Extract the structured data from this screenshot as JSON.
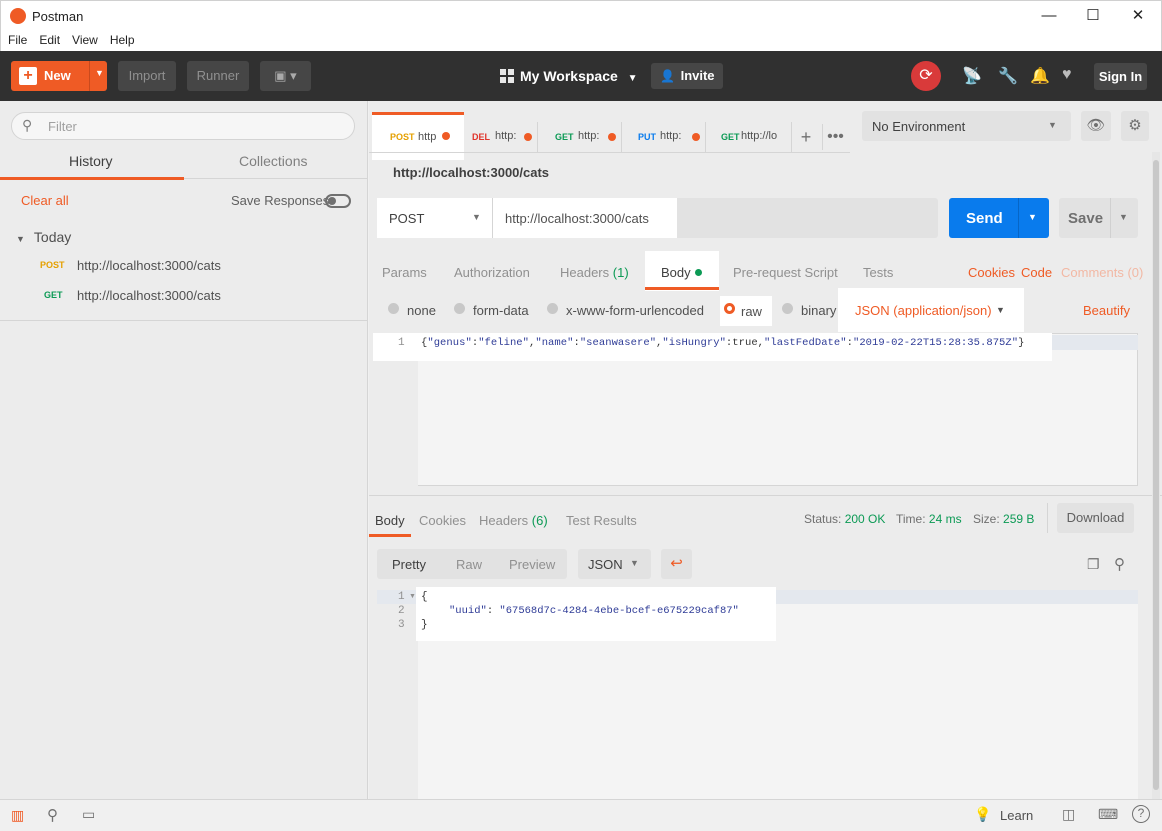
{
  "window": {
    "title": "Postman",
    "minimize": "—",
    "maximize": "☐",
    "close": "✕"
  },
  "menu": [
    "File",
    "Edit",
    "View",
    "Help"
  ],
  "header": {
    "new_label": "New",
    "import_label": "Import",
    "runner_label": "Runner",
    "workspace_label": "My Workspace",
    "invite_label": "Invite",
    "signin_label": "Sign In"
  },
  "sidebar": {
    "filter_placeholder": "Filter",
    "tabs": [
      "History",
      "Collections"
    ],
    "clear_all": "Clear all",
    "save_responses": "Save Responses",
    "group": "Today",
    "items": [
      {
        "method": "POST",
        "url": "http://localhost:3000/cats",
        "color": "#e5a000"
      },
      {
        "method": "GET",
        "url": "http://localhost:3000/cats",
        "color": "#0c9a55"
      }
    ]
  },
  "request_tabs": [
    {
      "method": "POST",
      "label": "http",
      "color": "#e5a000"
    },
    {
      "method": "DEL",
      "label": "http:",
      "color": "#e0332a"
    },
    {
      "method": "GET",
      "label": "http:",
      "color": "#0c9a55"
    },
    {
      "method": "PUT",
      "label": "http:",
      "color": "#097bed"
    },
    {
      "method": "GET",
      "label": "http://lo",
      "color": "#0c9a55"
    }
  ],
  "environment": "No Environment",
  "request": {
    "name": "http://localhost:3000/cats",
    "method": "POST",
    "url": "http://localhost:3000/cats",
    "send_label": "Send",
    "save_label": "Save",
    "tabs": {
      "params": "Params",
      "authorization": "Authorization",
      "headers": "Headers",
      "headers_count": "(1)",
      "body": "Body",
      "prerequest": "Pre-request Script",
      "tests": "Tests",
      "cookies": "Cookies",
      "code": "Code",
      "comments": "Comments (0)"
    },
    "body_modes": [
      "none",
      "form-data",
      "x-www-form-urlencoded",
      "raw",
      "binary"
    ],
    "content_type": "JSON (application/json)",
    "beautify": "Beautify",
    "body_line_no": "1",
    "body_parts": {
      "p1": "{",
      "k1": "\"genus\"",
      "c1": ":",
      "v1": "\"feline\"",
      "s1": ",",
      "k2": "\"name\"",
      "c2": ":",
      "v2": "\"seanwasere\"",
      "s2": ",",
      "k3": "\"isHungry\"",
      "c3": ":true,",
      "k4": "\"lastFedDate\"",
      "c4": ":",
      "v4": "\"2019-02-22T15:28:35.875Z\"",
      "p2": "}"
    }
  },
  "response": {
    "tabs": {
      "body": "Body",
      "cookies": "Cookies",
      "headers": "Headers",
      "headers_count": "(6)",
      "test_results": "Test Results"
    },
    "status_label": "Status:",
    "status_value": "200 OK",
    "time_label": "Time:",
    "time_value": "24 ms",
    "size_label": "Size:",
    "size_value": "259 B",
    "download_label": "Download",
    "view_modes": [
      "Pretty",
      "Raw",
      "Preview"
    ],
    "format": "JSON",
    "lines": [
      "1",
      "2",
      "3"
    ],
    "open_brace": "{",
    "key": "\"uuid\"",
    "colon": ": ",
    "value": "\"67568d7c-4284-4ebe-bcef-e675229caf87\"",
    "close_brace": "}"
  },
  "statusbar": {
    "learn_label": "Learn"
  }
}
